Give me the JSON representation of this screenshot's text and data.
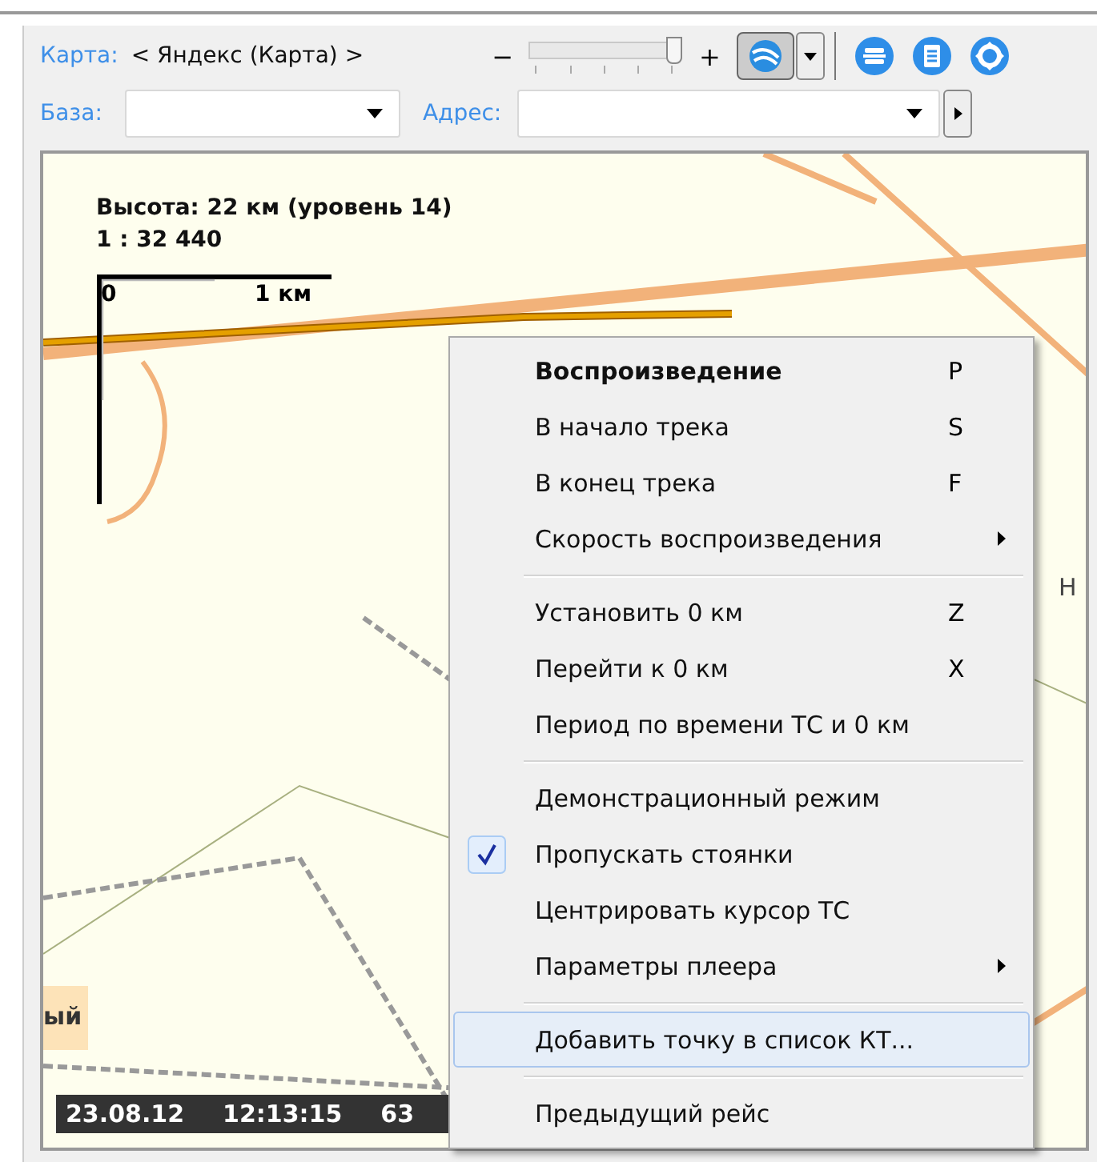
{
  "toolbar": {
    "map_label": "Карта:",
    "map_value": "< Яндекс (Карта) >",
    "zoom_minus": "−",
    "zoom_plus": "+",
    "zoom": {
      "level": 1.0
    },
    "base_label": "База:",
    "address_label": "Адрес:"
  },
  "map": {
    "altitude": "Высота: 22 км (уровень 14)",
    "scale_ratio": "1 : 32 440",
    "scale_zero": "0",
    "scale_km": "1 км",
    "place_left": "ый",
    "place_right": "Н",
    "footer": [
      "23.08.12",
      "12:13:15",
      "63"
    ]
  },
  "menu": [
    {
      "kind": "item",
      "label": "Воспроизведение",
      "shortcut": "P",
      "default": true,
      "checked": false,
      "selected": false,
      "submenu": false
    },
    {
      "kind": "item",
      "label": "В начало трека",
      "shortcut": "S",
      "default": false,
      "checked": false,
      "selected": false,
      "submenu": false
    },
    {
      "kind": "item",
      "label": "В конец трека",
      "shortcut": "F",
      "default": false,
      "checked": false,
      "selected": false,
      "submenu": false
    },
    {
      "kind": "item",
      "label": "Скорость воспроизведения",
      "default": false,
      "checked": false,
      "selected": false,
      "submenu": true
    },
    {
      "kind": "separator"
    },
    {
      "kind": "item",
      "label": "Установить 0 км",
      "shortcut": "Z",
      "default": false,
      "checked": false,
      "selected": false,
      "submenu": false
    },
    {
      "kind": "item",
      "label": "Перейти к 0 км",
      "shortcut": "X",
      "default": false,
      "checked": false,
      "selected": false,
      "submenu": false
    },
    {
      "kind": "item",
      "label": "Период по времени ТС и 0 км",
      "default": false,
      "checked": false,
      "selected": false,
      "submenu": false
    },
    {
      "kind": "separator"
    },
    {
      "kind": "item",
      "label": "Демонстрационный режим",
      "default": false,
      "checked": false,
      "selected": false,
      "submenu": false
    },
    {
      "kind": "item",
      "label": "Пропускать стоянки",
      "default": false,
      "checked": true,
      "selected": false,
      "submenu": false
    },
    {
      "kind": "item",
      "label": "Центрировать курсор ТС",
      "default": false,
      "checked": false,
      "selected": false,
      "submenu": false
    },
    {
      "kind": "item",
      "label": "Параметры плеера",
      "default": false,
      "checked": false,
      "selected": false,
      "submenu": true
    },
    {
      "kind": "separator"
    },
    {
      "kind": "item",
      "label": "Добавить точку в список КТ...",
      "default": false,
      "checked": false,
      "selected": true,
      "submenu": false
    },
    {
      "kind": "separator"
    },
    {
      "kind": "item",
      "label": "Предыдущий рейс",
      "default": false,
      "checked": false,
      "selected": false,
      "submenu": false
    }
  ]
}
